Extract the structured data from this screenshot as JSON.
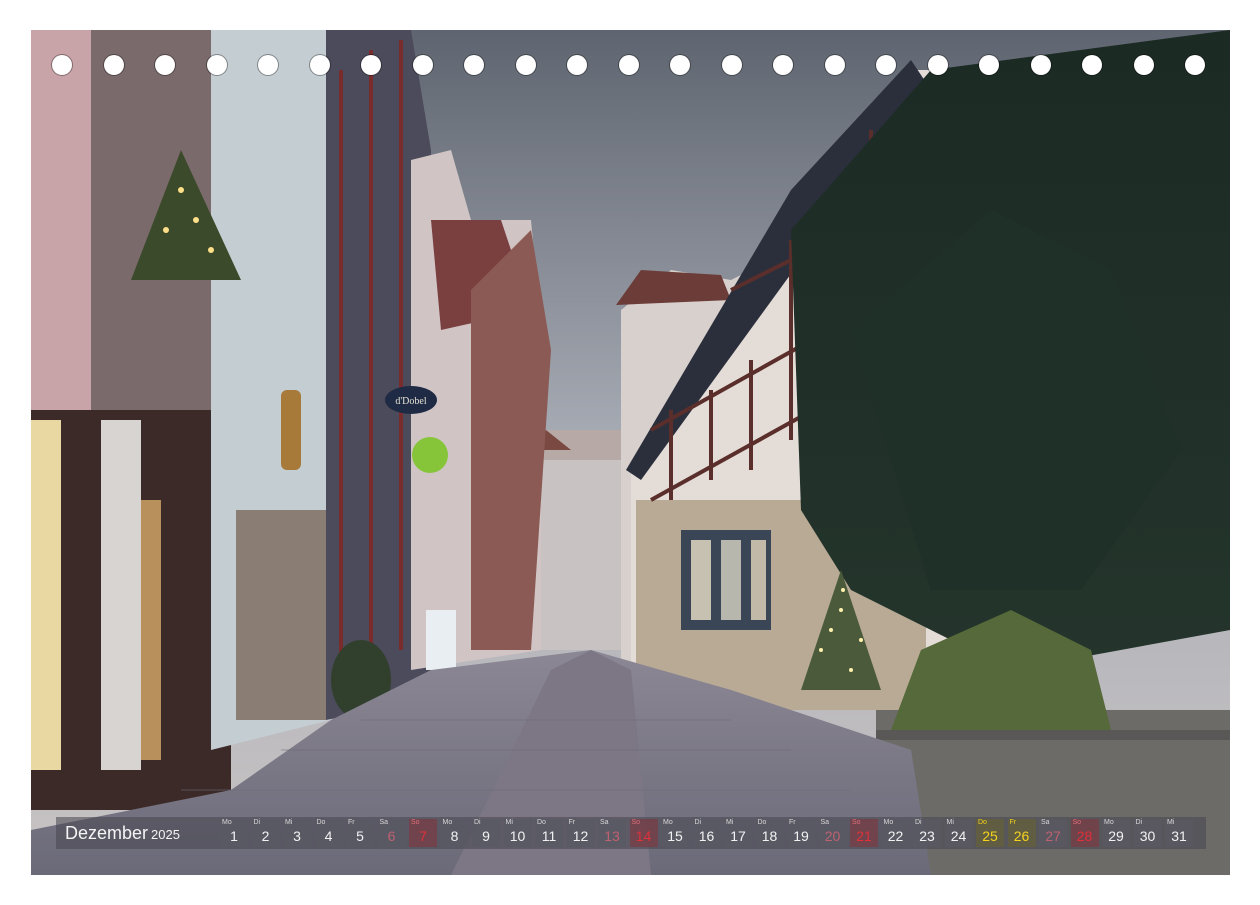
{
  "calendar": {
    "month": "Dezember",
    "year": "2025",
    "days": [
      {
        "wd": "Mo",
        "n": "1",
        "type": "weekday"
      },
      {
        "wd": "Di",
        "n": "2",
        "type": "weekday"
      },
      {
        "wd": "Mi",
        "n": "3",
        "type": "weekday"
      },
      {
        "wd": "Do",
        "n": "4",
        "type": "weekday"
      },
      {
        "wd": "Fr",
        "n": "5",
        "type": "weekday"
      },
      {
        "wd": "Sa",
        "n": "6",
        "type": "sat"
      },
      {
        "wd": "So",
        "n": "7",
        "type": "sun"
      },
      {
        "wd": "Mo",
        "n": "8",
        "type": "weekday"
      },
      {
        "wd": "Di",
        "n": "9",
        "type": "weekday"
      },
      {
        "wd": "Mi",
        "n": "10",
        "type": "weekday"
      },
      {
        "wd": "Do",
        "n": "11",
        "type": "weekday"
      },
      {
        "wd": "Fr",
        "n": "12",
        "type": "weekday"
      },
      {
        "wd": "Sa",
        "n": "13",
        "type": "sat"
      },
      {
        "wd": "So",
        "n": "14",
        "type": "sun"
      },
      {
        "wd": "Mo",
        "n": "15",
        "type": "weekday"
      },
      {
        "wd": "Di",
        "n": "16",
        "type": "weekday"
      },
      {
        "wd": "Mi",
        "n": "17",
        "type": "weekday"
      },
      {
        "wd": "Do",
        "n": "18",
        "type": "weekday"
      },
      {
        "wd": "Fr",
        "n": "19",
        "type": "weekday"
      },
      {
        "wd": "Sa",
        "n": "20",
        "type": "sat"
      },
      {
        "wd": "So",
        "n": "21",
        "type": "sun"
      },
      {
        "wd": "Mo",
        "n": "22",
        "type": "weekday"
      },
      {
        "wd": "Di",
        "n": "23",
        "type": "weekday"
      },
      {
        "wd": "Mi",
        "n": "24",
        "type": "weekday"
      },
      {
        "wd": "Do",
        "n": "25",
        "type": "hol"
      },
      {
        "wd": "Fr",
        "n": "26",
        "type": "hol"
      },
      {
        "wd": "Sa",
        "n": "27",
        "type": "sat"
      },
      {
        "wd": "So",
        "n": "28",
        "type": "sun"
      },
      {
        "wd": "Mo",
        "n": "29",
        "type": "weekday"
      },
      {
        "wd": "Di",
        "n": "30",
        "type": "weekday"
      },
      {
        "wd": "Mi",
        "n": "31",
        "type": "weekday"
      }
    ]
  },
  "signs": {
    "shop_sign": "d'Dobel"
  },
  "colors": {
    "sunday": "#e0303a",
    "holiday": "#f5d21c"
  },
  "binding_holes": 23
}
